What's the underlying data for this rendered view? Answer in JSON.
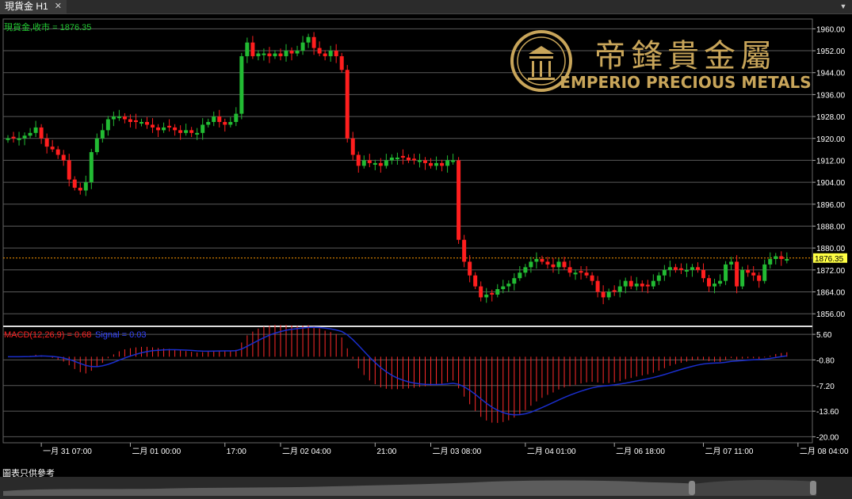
{
  "window": {
    "tab_title": "現貨金 H1",
    "close_glyph": "✕",
    "menu_glyph": "▼"
  },
  "footer": {
    "note": "圖表只供參考"
  },
  "watermark": {
    "cn": "帝鋒貴金屬",
    "en": "EMPERIO PRECIOUS METALS"
  },
  "colors": {
    "bull": "#22bb33",
    "bear": "#ff1e1e",
    "signal": "#1a2ecc",
    "hist": "#ff2a2a",
    "grid": "#5a5a5a",
    "last_line": "#ff9900",
    "gold": "#c8a55a"
  },
  "chart_data": [
    {
      "type": "candlestick",
      "legend": "現貨金,收市 = 1876.35",
      "y_ticks": [
        "1960.00",
        "1952.00",
        "1944.00",
        "1936.00",
        "1928.00",
        "1920.00",
        "1912.00",
        "1904.00",
        "1896.00",
        "1888.00",
        "1880.00",
        "1872.00",
        "1864.00",
        "1856.00"
      ],
      "ylim": [
        1852,
        1963
      ],
      "last_price": "1876.35",
      "x_tick_labels": [
        "一月 31 07:00",
        "二月 01 00:00",
        "17:00",
        "二月 02 04:00",
        "21:00",
        "二月 03 08:00",
        "二月 04 01:00",
        "二月 06 18:00",
        "二月 07 11:00",
        "二月 08 04:00"
      ],
      "x_tick_bar_index": [
        6,
        22,
        39,
        49,
        66,
        76,
        93,
        109,
        125,
        142
      ],
      "close": [
        1920,
        1920,
        1920,
        1921,
        1922,
        1924,
        1920,
        1917,
        1916,
        1914,
        1912,
        1905,
        1902,
        1901,
        1904,
        1915,
        1920,
        1923,
        1927,
        1928,
        1928,
        1927,
        1926,
        1926,
        1926,
        1925,
        1924,
        1923,
        1924,
        1924,
        1923,
        1922,
        1923,
        1922,
        1922,
        1925,
        1926,
        1928,
        1926,
        1925,
        1926,
        1929,
        1950,
        1955,
        1950,
        1951,
        1951,
        1950,
        1951,
        1950,
        1952,
        1951,
        1952,
        1955,
        1957,
        1953,
        1951,
        1950,
        1952,
        1950,
        1945,
        1920,
        1914,
        1910,
        1912,
        1911,
        1911,
        1910,
        1912,
        1913,
        1913,
        1913,
        1912,
        1912,
        1912,
        1911,
        1910,
        1911,
        1910,
        1912,
        1912,
        1883,
        1875,
        1870,
        1866,
        1862,
        1863,
        1863,
        1865,
        1866,
        1867,
        1869,
        1871,
        1873,
        1875,
        1876,
        1875,
        1874,
        1873,
        1875,
        1873,
        1871,
        1871,
        1871,
        1870,
        1868,
        1864,
        1862,
        1864,
        1864,
        1866,
        1868,
        1866,
        1867,
        1866,
        1866,
        1868,
        1870,
        1872,
        1873,
        1872,
        1872,
        1872,
        1873,
        1872,
        1869,
        1866,
        1867,
        1868,
        1874,
        1875,
        1866,
        1872,
        1871,
        1870,
        1868,
        1874,
        1876,
        1877,
        1876,
        1876
      ],
      "macd": {
        "label": "MACD(12,26,9) = 0.68",
        "signal_label": "Signal = 0.03",
        "y_ticks": [
          "5.60",
          "-0.80",
          "-7.20",
          "-13.60",
          "-20.00"
        ],
        "ylim": [
          -21.5,
          7.2
        ]
      }
    }
  ]
}
